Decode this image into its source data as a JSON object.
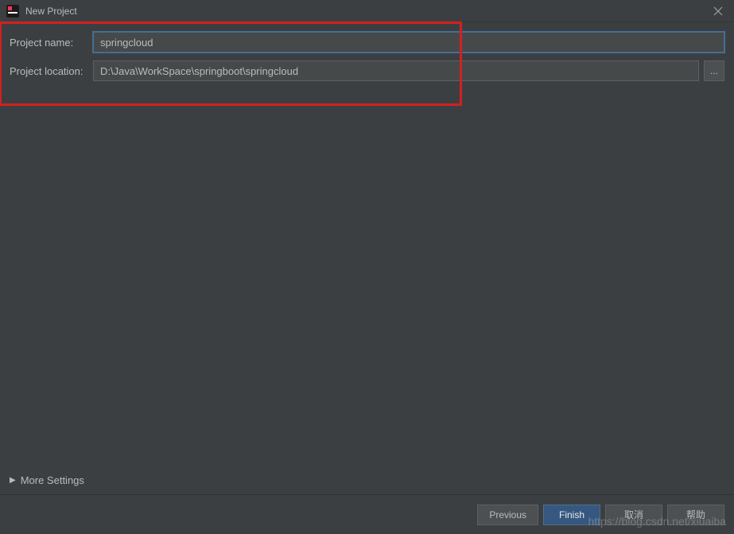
{
  "titlebar": {
    "title": "New Project"
  },
  "form": {
    "project_name_label": "Project name:",
    "project_name_value": "springcloud",
    "project_location_label": "Project location:",
    "project_location_value": "D:\\Java\\WorkSpace\\springboot\\springcloud",
    "browse_label": "..."
  },
  "more_settings_label": "More Settings",
  "buttons": {
    "previous": "Previous",
    "finish": "Finish",
    "cancel": "取消",
    "help": "帮助"
  },
  "watermark": "https://blog.csdn.net/xiuaiba"
}
